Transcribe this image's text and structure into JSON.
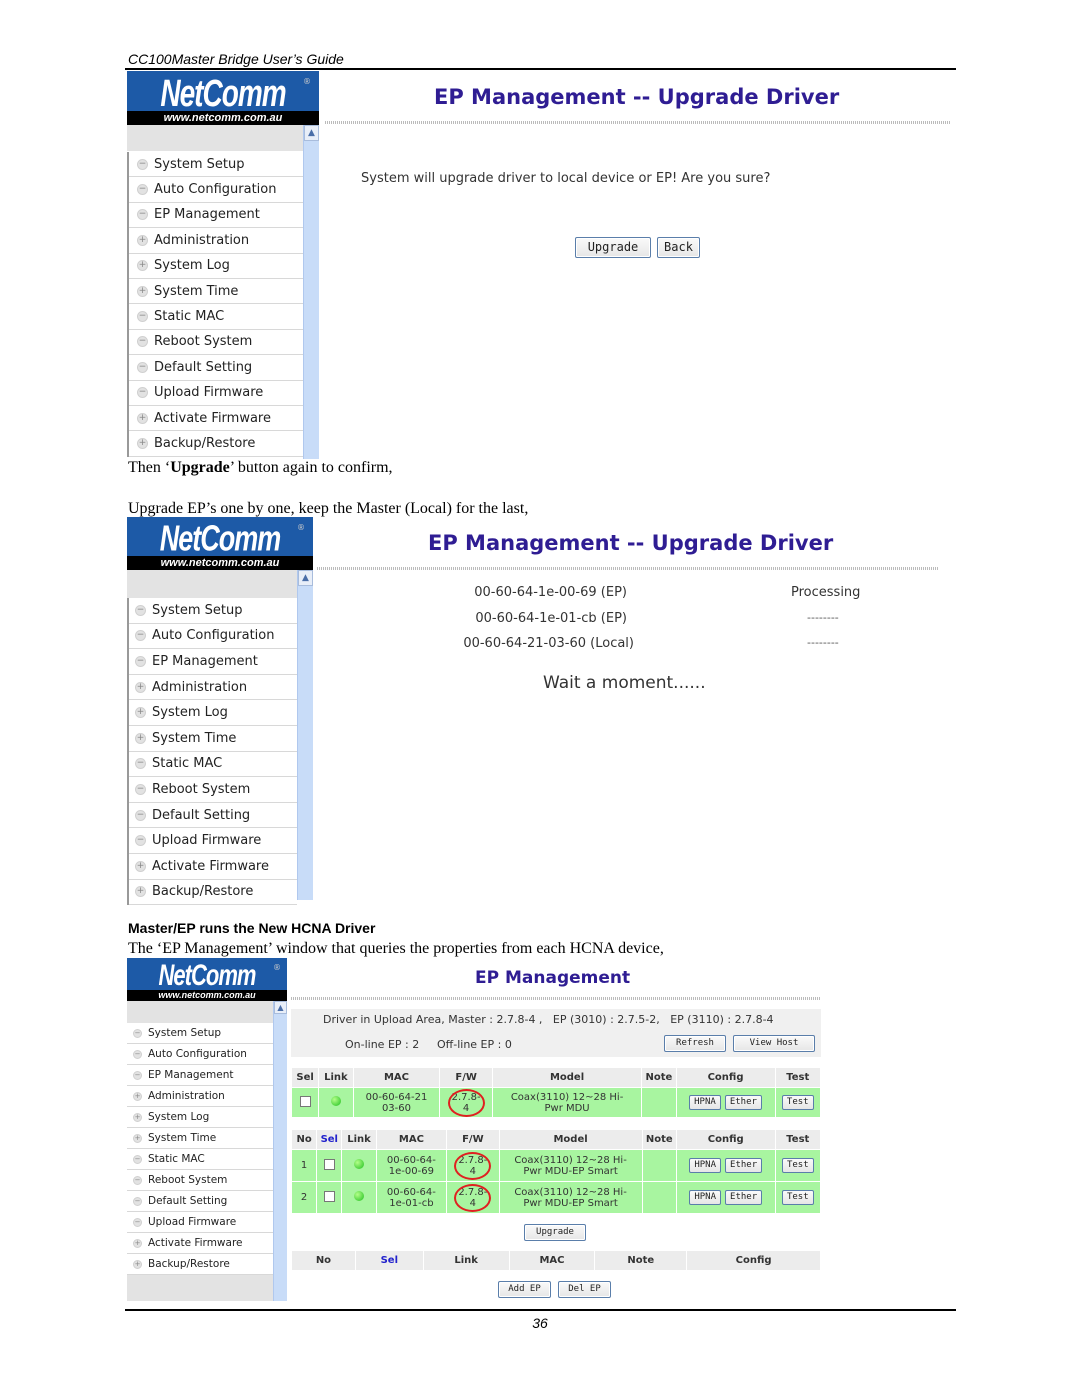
{
  "doc": {
    "header": "CC100Master Bridge User’s Guide",
    "page_number": "36",
    "para_confirm_prefix": "Then ‘",
    "para_confirm_bold": "Upgrade",
    "para_confirm_suffix": "’ button again to confirm,",
    "para_one_by_one": "Upgrade EP’s one by one, keep the Master (Local) for the last,",
    "heading_new_driver": "Master/EP runs the New HCNA Driver",
    "para_ep_window": "The ‘EP Management’ window that queries the properties from each HCNA device,"
  },
  "logo": {
    "brand": "NetComm",
    "url": "www.netcomm.com.au",
    "reg": "®"
  },
  "menu": [
    {
      "label": "System Setup",
      "icon": "minus"
    },
    {
      "label": "Auto Configuration",
      "icon": "minus"
    },
    {
      "label": "EP Management",
      "icon": "minus"
    },
    {
      "label": "Administration",
      "icon": "plus"
    },
    {
      "label": "System Log",
      "icon": "plus"
    },
    {
      "label": "System Time",
      "icon": "plus"
    },
    {
      "label": "Static MAC",
      "icon": "minus"
    },
    {
      "label": "Reboot System",
      "icon": "minus"
    },
    {
      "label": "Default Setting",
      "icon": "minus"
    },
    {
      "label": "Upload Firmware",
      "icon": "minus"
    },
    {
      "label": "Activate Firmware",
      "icon": "plus"
    },
    {
      "label": "Backup/Restore",
      "icon": "plus"
    }
  ],
  "shot1": {
    "title": "EP Management -- Upgrade Driver",
    "message": "System will upgrade driver to local device or EP! Are you sure?",
    "upgrade_label": "Upgrade",
    "back_label": "Back"
  },
  "shot2": {
    "title": "EP Management -- Upgrade Driver",
    "devices": [
      {
        "mac": "00-60-64-1e-00-69 (EP)",
        "status": "Processing"
      },
      {
        "mac": "00-60-64-1e-01-cb (EP)",
        "status": "--------"
      },
      {
        "mac": "00-60-64-21-03-60 (Local)",
        "status": "--------"
      }
    ],
    "wait": "Wait a moment......"
  },
  "shot3": {
    "title": "EP Management",
    "driver_info": "Driver in Upload Area, Master : 2.7.8-4 ,   EP (3010) : 2.7.5-2,   EP (3110) : 2.7.8-4",
    "online": "On-line EP : 2",
    "offline": "Off-line EP : 0",
    "refresh_label": "Refresh",
    "viewhost_label": "View Host",
    "master_headers": [
      "Sel",
      "Link",
      "MAC",
      "F/W",
      "Model",
      "Note",
      "Config",
      "Test"
    ],
    "master_row": {
      "mac1": "00-60-64-21",
      "mac2": "03-60",
      "fw1": "2.7.8-",
      "fw2": "4",
      "model1": "Coax(3110) 12~28 Hi-",
      "model2": "Pwr MDU",
      "note": "",
      "hpna": "HPNA",
      "ether": "Ether",
      "test": "Test"
    },
    "ep_headers": [
      "No",
      "Sel",
      "Link",
      "MAC",
      "F/W",
      "Model",
      "Note",
      "Config",
      "Test"
    ],
    "ep_rows": [
      {
        "no": "1",
        "mac1": "00-60-64-",
        "mac2": "1e-00-69",
        "fw1": "2.7.8-",
        "fw2": "4",
        "model1": "Coax(3110) 12~28 Hi-",
        "model2": "Pwr MDU-EP Smart",
        "note": "",
        "hpna": "HPNA",
        "ether": "Ether",
        "test": "Test"
      },
      {
        "no": "2",
        "mac1": "00-60-64-",
        "mac2": "1e-01-cb",
        "fw1": "2.7.8-",
        "fw2": "4",
        "model1": "Coax(3110) 12~28 Hi-",
        "model2": "Pwr MDU-EP Smart",
        "note": "",
        "hpna": "HPNA",
        "ether": "Ether",
        "test": "Test"
      }
    ],
    "upgrade_label": "Upgrade",
    "static_headers": [
      "No",
      "Sel",
      "Link",
      "MAC",
      "Note",
      "Config"
    ],
    "add_ep_label": "Add EP",
    "del_ep_label": "Del EP"
  },
  "colors": {
    "title": "#2f1d93",
    "row_green": "#a8f5a0",
    "circle": "#e02020",
    "logo_blue": "#1d5aa7"
  }
}
